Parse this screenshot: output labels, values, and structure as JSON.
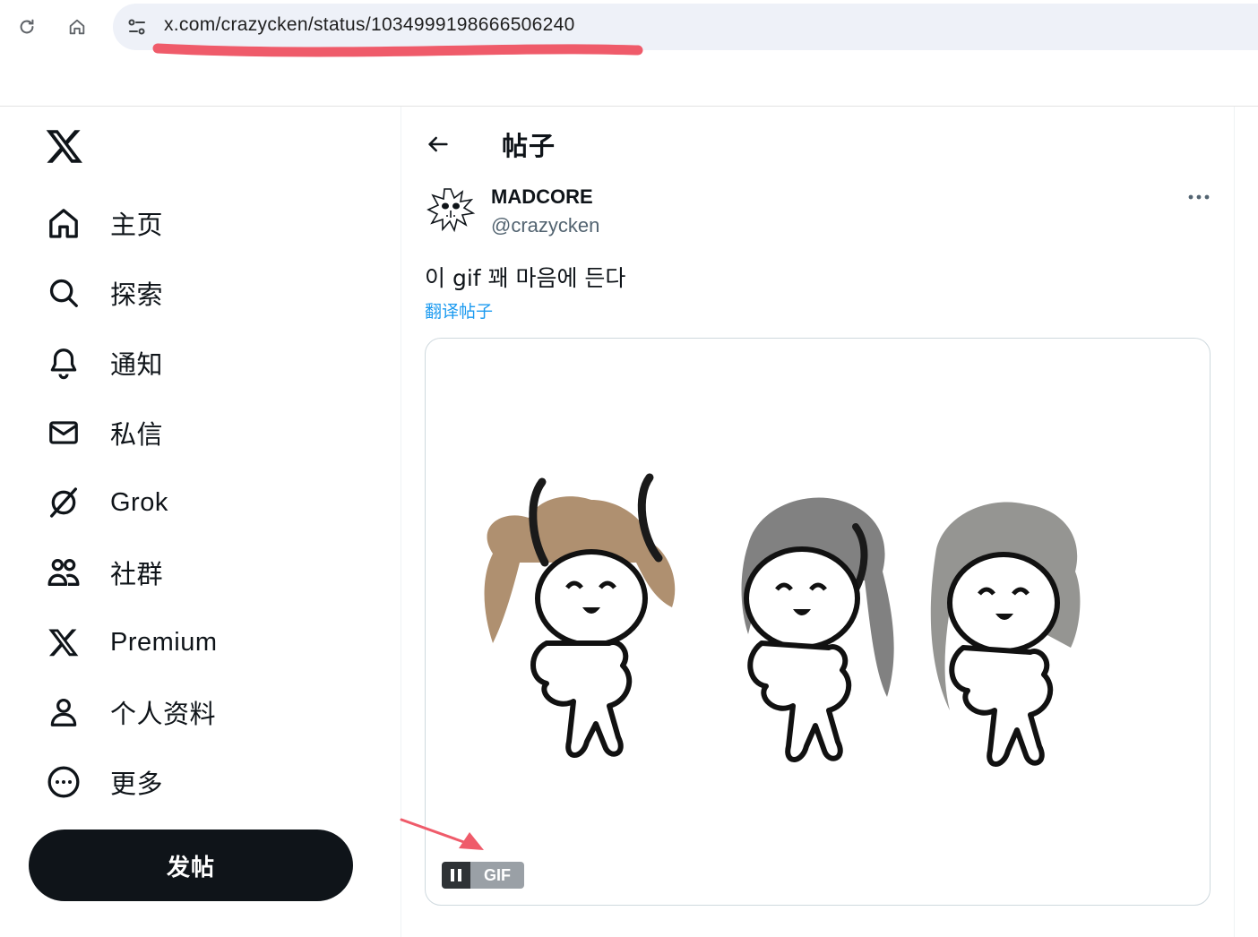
{
  "browser": {
    "url": "x.com/crazycken/status/1034999198666506240",
    "icons": [
      "reload-icon",
      "home-icon",
      "site-info-icon"
    ],
    "annotation_color": "#ef5b6a"
  },
  "sidebar": {
    "logo": "x-logo-icon",
    "items": [
      {
        "label": "主页",
        "icon": "home-icon"
      },
      {
        "label": "探索",
        "icon": "search-icon"
      },
      {
        "label": "通知",
        "icon": "bell-icon"
      },
      {
        "label": "私信",
        "icon": "envelope-icon"
      },
      {
        "label": "Grok",
        "icon": "grok-icon"
      },
      {
        "label": "社群",
        "icon": "people-icon"
      },
      {
        "label": "Premium",
        "icon": "x-logo-icon"
      },
      {
        "label": "个人资料",
        "icon": "person-icon"
      },
      {
        "label": "更多",
        "icon": "more-circle-icon"
      }
    ],
    "post_button": "发帖"
  },
  "header": {
    "title": "帖子",
    "back_icon": "arrow-left-icon"
  },
  "post": {
    "author_name": "MADCORE",
    "author_handle": "@crazycken",
    "text": "이 gif 꽤 마음에 든다",
    "translate": "翻译帖子",
    "media_type_label": "GIF",
    "more_icon": "ellipsis-icon"
  },
  "colors": {
    "text": "#0f1419",
    "secondary": "#536471",
    "link": "#1d9bf0",
    "button_bg": "#0f1419"
  }
}
